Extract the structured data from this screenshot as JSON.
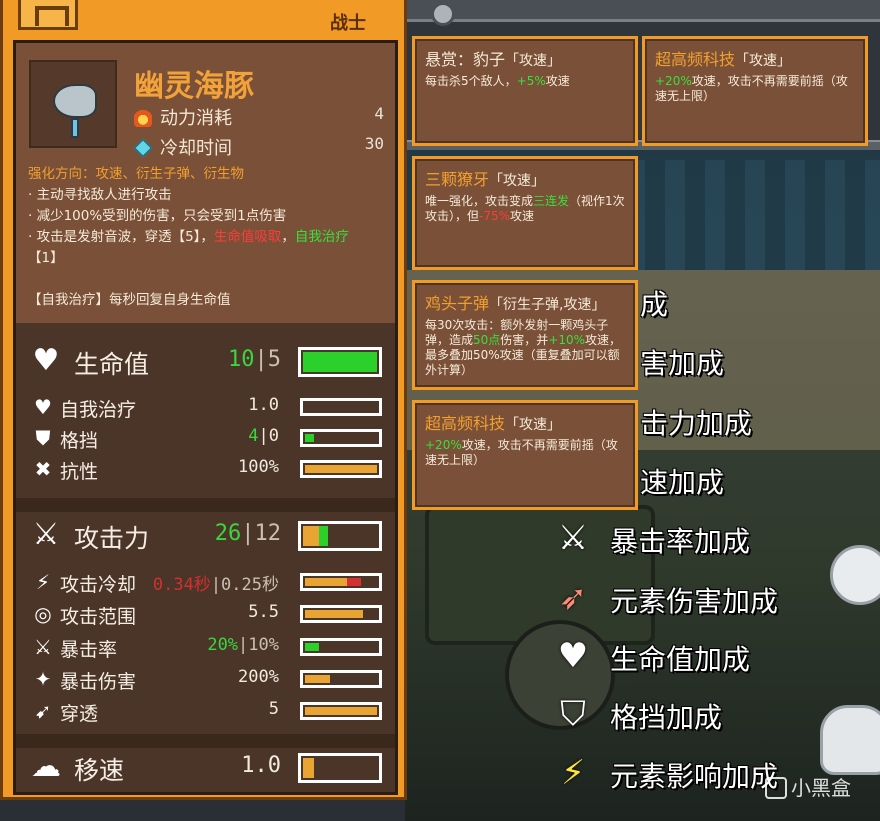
{
  "panel": {
    "class_label": "战士",
    "hero": {
      "name": "幽灵海豚",
      "costs": [
        {
          "icon": "fire-icon",
          "label": "动力消耗",
          "value": "4"
        },
        {
          "icon": "gem-icon",
          "label": "冷却时间",
          "value": "30"
        }
      ],
      "direction": "强化方向：攻速、衍生子弹、衍生物",
      "bullets": [
        "· 主动寻找敌人进行攻击",
        "· 减少100%受到的伤害，只会受到1点伤害",
        "· 攻击是发射音波，穿透【5】，",
        "生命值吸取",
        "，",
        "自我治疗",
        "【1】"
      ],
      "self_heal_note": "【自我治疗】每秒回复自身生命值"
    },
    "health": {
      "label": "生命值",
      "current": "10",
      "base": "5",
      "fill": 1.0
    },
    "defense_stats": [
      {
        "name": "self-heal",
        "icon": "heal-icon",
        "label": "自我治疗",
        "value": "1.0",
        "fill": 0.0
      },
      {
        "name": "block",
        "icon": "shield-icon",
        "label": "格挡",
        "value_g": "4",
        "value_rest": "|0",
        "fill": 0.12
      },
      {
        "name": "resist",
        "icon": "resist-icon",
        "label": "抗性",
        "value": "100%",
        "fill": 1.0
      }
    ],
    "attack": {
      "label": "攻击力",
      "current": "26",
      "base": "12",
      "fill_orange": 0.22,
      "fill_green": 0.12
    },
    "attack_stats": [
      {
        "name": "attack-cooldown",
        "icon": "cooldown-icon",
        "label": "攻击冷却",
        "value_r": "0.34秒",
        "value_rest": "|0.25秒",
        "fill": 0.78,
        "red_tail": 0.2
      },
      {
        "name": "attack-range",
        "icon": "range-icon",
        "label": "攻击范围",
        "value": "5.5",
        "fill": 0.8
      },
      {
        "name": "crit-rate",
        "icon": "crit-icon",
        "label": "暴击率",
        "value_g": "20%",
        "value_rest": "|10%",
        "fill": 0.2
      },
      {
        "name": "crit-damage",
        "icon": "crit-damage-icon",
        "label": "暴击伤害",
        "value": "200%",
        "fill": 0.35
      },
      {
        "name": "pierce",
        "icon": "pierce-icon",
        "label": "穿透",
        "value": "5",
        "fill": 1.0
      }
    ],
    "move": {
      "label": "移速",
      "value": "1.0",
      "fill": 0.15
    }
  },
  "cards": [
    {
      "name": "card-leopard-bounty",
      "title": "悬赏：豹子",
      "tag": "「攻速」",
      "orange_title": false,
      "body": [
        {
          "t": "每击杀5个敌人，"
        },
        {
          "t": "+5%",
          "c": "g"
        },
        {
          "t": "攻速"
        }
      ]
    },
    {
      "name": "card-superfreq-top",
      "title": "超高频科技",
      "tag": "「攻速」",
      "orange_title": true,
      "body": [
        {
          "t": "+20%",
          "c": "g"
        },
        {
          "t": "攻速，攻击不再需要前摇（攻速无上限）"
        }
      ]
    },
    {
      "name": "card-triple-fang",
      "title": "三颗獠牙",
      "tag": "「攻速」",
      "orange_title": true,
      "body": [
        {
          "t": "唯一强化，攻击变成"
        },
        {
          "t": "三连发",
          "c": "g"
        },
        {
          "t": "（视作1次攻击），但"
        },
        {
          "t": "-75%",
          "c": "r"
        },
        {
          "t": "攻速"
        }
      ]
    },
    {
      "name": "card-chicken-bullet",
      "title": "鸡头子弹",
      "tag": "「衍生子弹,攻速」",
      "orange_title": true,
      "body": [
        {
          "t": "每30次攻击：额外发射一颗鸡头子弹，造成"
        },
        {
          "t": "50点",
          "c": "g"
        },
        {
          "t": "伤害，并"
        },
        {
          "t": "+10%",
          "c": "g"
        },
        {
          "t": "攻速，最多叠加50%攻速（重复叠加可以额外计算）"
        }
      ]
    },
    {
      "name": "card-superfreq",
      "title": "超高频科技",
      "tag": "「攻速」",
      "orange_title": true,
      "body": [
        {
          "t": "+20%",
          "c": "g"
        },
        {
          "t": "攻速，攻击不再需要前摇（攻速无上限）"
        }
      ]
    }
  ],
  "bonus_partials": [
    "成",
    "害加成",
    "击力加成",
    "速加成"
  ],
  "bonuses": [
    {
      "name": "bonus-crit-rate",
      "icon": "crit-icon",
      "label": "暴击率加成"
    },
    {
      "name": "bonus-element-damage",
      "icon": "element-damage-icon",
      "label": "元素伤害加成"
    },
    {
      "name": "bonus-health",
      "icon": "heart-icon",
      "label": "生命值加成"
    },
    {
      "name": "bonus-block",
      "icon": "shield-icon",
      "label": "格挡加成"
    },
    {
      "name": "bonus-element-effect",
      "icon": "lightning-icon",
      "label": "元素影响加成"
    }
  ],
  "watermark": "小黑盒"
}
